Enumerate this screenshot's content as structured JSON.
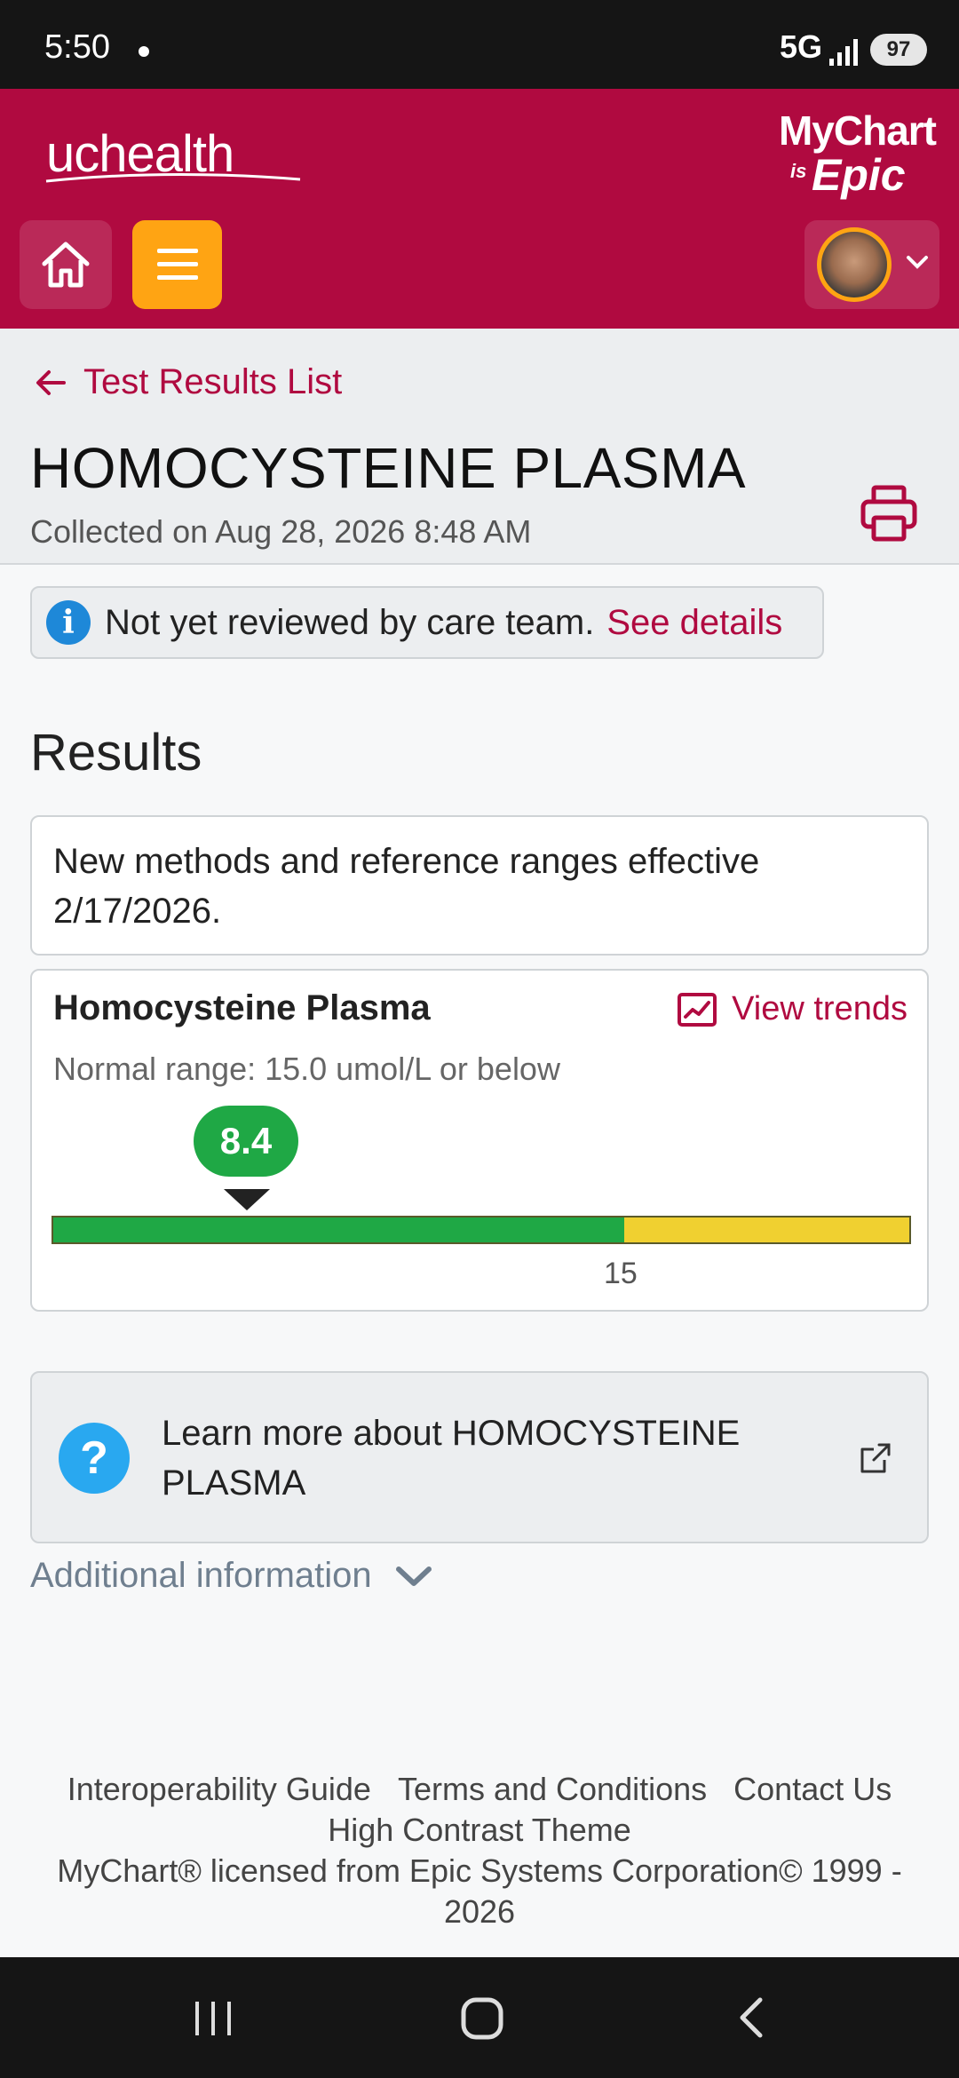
{
  "status_bar": {
    "time": "5:50",
    "network": "5G",
    "battery": "97"
  },
  "header": {
    "brand": "uchealth",
    "mychart_logo": {
      "line1": "MyChart",
      "is": "is",
      "epic": "Epic"
    },
    "profile_menu_icon": "chevron-down-icon"
  },
  "colors": {
    "header_bg": "#b00a40",
    "accent_orange": "#ffa413",
    "link": "#b00a40",
    "normal_green": "#1fa845",
    "high_yellow": "#f0d030"
  },
  "nav": {
    "back_link": "Test Results List"
  },
  "test": {
    "title": "HOMOCYSTEINE PLASMA",
    "collected": "Collected on Aug 28, 2026 8:48 AM"
  },
  "review": {
    "text": "Not yet reviewed by care team.",
    "link": "See details"
  },
  "results": {
    "heading": "Results",
    "note": "New methods and reference ranges effective 2/17/2026.",
    "component": {
      "name": "Homocysteine Plasma",
      "trends_link": "View trends",
      "normal_range": "Normal range: 15.0 umol/L or below",
      "value": "8.4",
      "range_tick": "15"
    }
  },
  "range_scale": {
    "normal_fraction": 0.667
  },
  "learn_more": {
    "text": "Learn more about HOMOCYSTEINE PLASMA"
  },
  "additional_info": {
    "label": "Additional information"
  },
  "footer": {
    "links": [
      "Interoperability Guide",
      "Terms and Conditions",
      "Contact Us",
      "High Contrast Theme"
    ],
    "license": "MyChart® licensed from Epic Systems Corporation© 1999 - 2026"
  }
}
